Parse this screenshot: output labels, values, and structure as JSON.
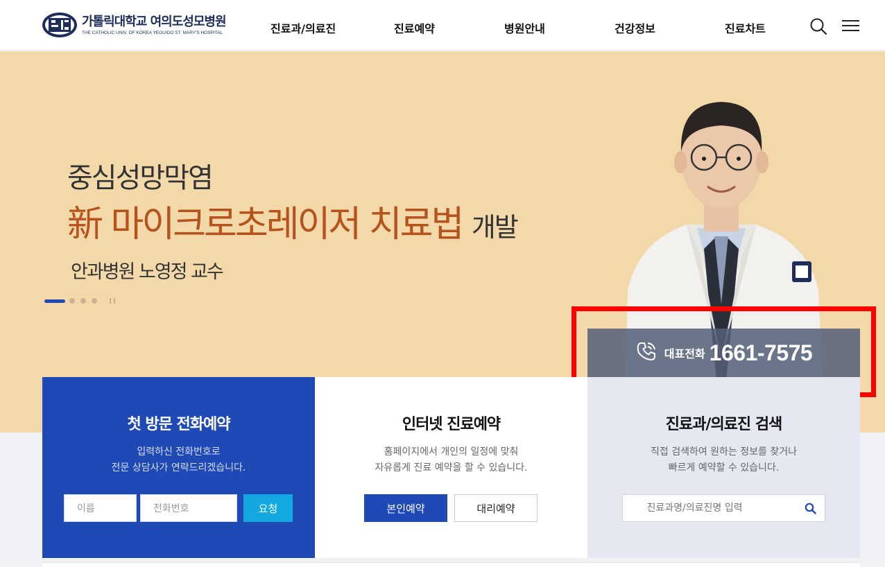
{
  "header": {
    "logo_kr": "가톨릭대학교 여의도성모병원",
    "logo_en": "THE CATHOLIC UNIV. OF KOREA YEOUIDO ST. MARY'S HOSPITAL",
    "nav": [
      "진료과/의료진",
      "진료예약",
      "병원안내",
      "건강정보",
      "진료차트"
    ],
    "icons": [
      "search-icon",
      "hamburger-menu-icon"
    ]
  },
  "hero": {
    "subtitle": "중심성망막염",
    "headline": "新 마이크로초레이저 치료법",
    "headline_tail": "개발",
    "doctor": "안과병원 노영정 교수",
    "slides": 4,
    "active_slide": 1
  },
  "phone": {
    "label": "대표전화",
    "number": "1661-7575"
  },
  "cards": {
    "phone_reservation": {
      "title": "첫 방문 전화예약",
      "desc1": "입력하신 전화번호로",
      "desc2": "전문 상담사가 연락드리겠습니다.",
      "name_placeholder": "이름",
      "phone_placeholder": "전화번호",
      "submit": "요청"
    },
    "internet_reservation": {
      "title": "인터넷 진료예약",
      "desc1": "홈페이지에서 개인의 일정에 맞춰",
      "desc2": "자유롭게 진료 예약을 할 수 있습니다.",
      "self_button": "본인예약",
      "proxy_button": "대리예약"
    },
    "search": {
      "title": "진료과/의료진 검색",
      "desc1": "직접 검색하여 원하는 정보를 찾거나",
      "desc2": "빠르게 예약할 수 있습니다.",
      "placeholder": "진료과명/의료진명 입력"
    }
  },
  "colors": {
    "brand_navy": "#1e2d5c",
    "accent_blue": "#1f4ab5",
    "hero_bg": "#f3d8a9",
    "headline": "#b6521c",
    "request_button": "#13a8e2",
    "highlight": "#ff0000"
  }
}
